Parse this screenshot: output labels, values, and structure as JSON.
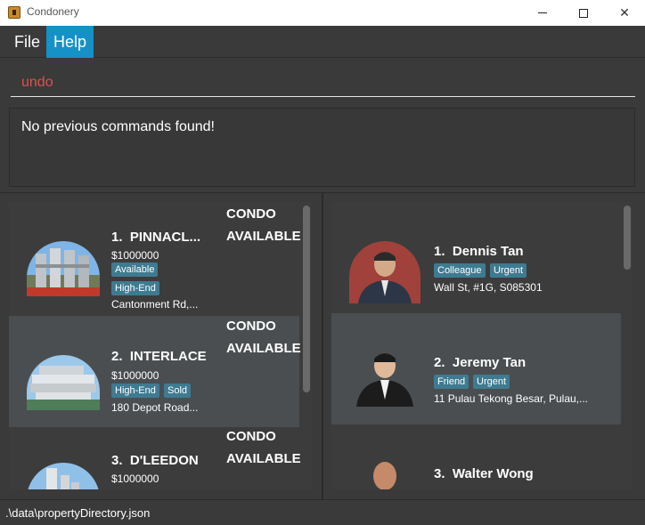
{
  "window": {
    "title": "Condonery"
  },
  "menu": {
    "file": "File",
    "help": "Help"
  },
  "command": {
    "value": "undo"
  },
  "result": {
    "text": "No previous commands found!"
  },
  "properties": [
    {
      "index": "1.",
      "name": "PINNACL...",
      "price": "$1000000",
      "tags": [
        "Available",
        "High-End"
      ],
      "address": "Cantonment Rd,...",
      "type": "CONDO",
      "status": "AVAILABLE"
    },
    {
      "index": "2.",
      "name": "INTERLACE",
      "price": "$1000000",
      "tags": [
        "High-End",
        "Sold"
      ],
      "address": "180 Depot Road...",
      "type": "CONDO",
      "status": "AVAILABLE"
    },
    {
      "index": "3.",
      "name": "D'LEEDON",
      "price": "$1000000",
      "tags": [],
      "address": "",
      "type": "CONDO",
      "status": "AVAILABLE"
    }
  ],
  "clients": [
    {
      "index": "1.",
      "name": "Dennis Tan",
      "tags": [
        "Colleague",
        "Urgent"
      ],
      "address": "Wall St, #1G, S085301"
    },
    {
      "index": "2.",
      "name": "Jeremy Tan",
      "tags": [
        "Friend",
        "Urgent"
      ],
      "address": "11 Pulau Tekong Besar, Pulau,..."
    },
    {
      "index": "3.",
      "name": "Walter Wong",
      "tags": [],
      "address": ""
    }
  ],
  "status": {
    "path": ".\\data\\propertyDirectory.json"
  },
  "colors": {
    "accent": "#1591c7",
    "tag": "#3e7b91",
    "error_text": "#d9534f"
  }
}
